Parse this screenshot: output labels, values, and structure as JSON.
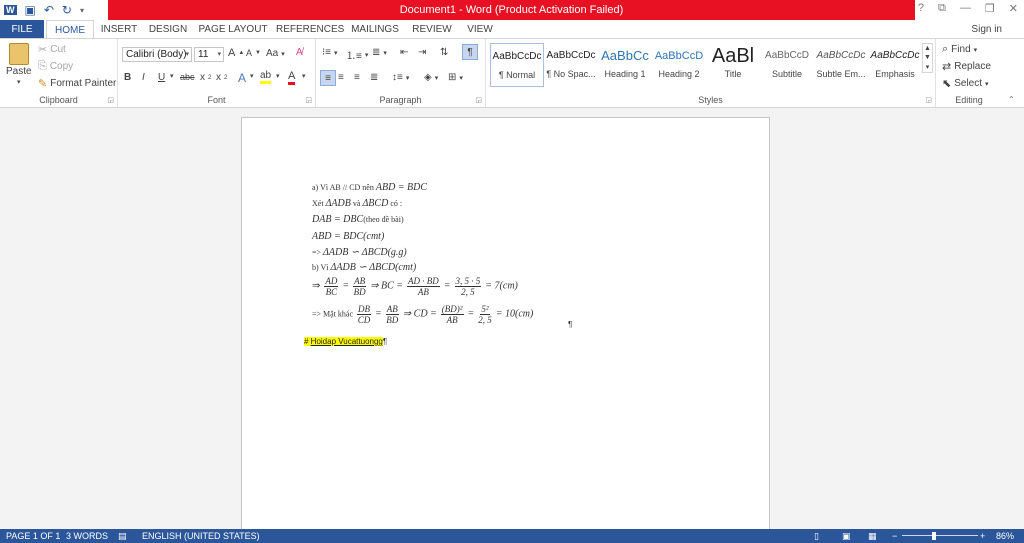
{
  "window": {
    "title": "Document1 - Word (Product Activation Failed)",
    "controls": [
      "?",
      "⧉",
      "—",
      "❐",
      "✕"
    ]
  },
  "qat": {
    "word_icon": "word-logo-icon",
    "save": "save-icon",
    "undo": "undo-icon",
    "redo": "redo-icon"
  },
  "tabs": {
    "file": "FILE",
    "home": "HOME",
    "insert": "INSERT",
    "design": "DESIGN",
    "page_layout": "PAGE LAYOUT",
    "references": "REFERENCES",
    "mailings": "MAILINGS",
    "review": "REVIEW",
    "view": "VIEW",
    "sign_in": "Sign in"
  },
  "clipboard": {
    "paste": "Paste",
    "cut": "Cut",
    "copy": "Copy",
    "format_painter": "Format Painter",
    "label": "Clipboard"
  },
  "font": {
    "name": "Calibri (Body)",
    "size": "11",
    "case": "Aa",
    "label": "Font"
  },
  "paragraph": {
    "label": "Paragraph"
  },
  "styles": {
    "label": "Styles",
    "items": [
      {
        "sample": "AaBbCcDc",
        "name": "¶ Normal"
      },
      {
        "sample": "AaBbCcDc",
        "name": "¶ No Spac..."
      },
      {
        "sample": "AaBbCc",
        "name": "Heading 1"
      },
      {
        "sample": "AaBbCcD",
        "name": "Heading 2"
      },
      {
        "sample": "AaBl",
        "name": "Title"
      },
      {
        "sample": "AaBbCcD",
        "name": "Subtitle"
      },
      {
        "sample": "AaBbCcDc",
        "name": "Subtle Em..."
      },
      {
        "sample": "AaBbCcDc",
        "name": "Emphasis"
      }
    ]
  },
  "editing": {
    "find": "Find",
    "replace": "Replace",
    "select": "Select",
    "label": "Editing"
  },
  "document": {
    "l1_text": "a) Vì AB // CD nên ",
    "l1_math": "ABD = BDC",
    "l2_text": "Xét ",
    "l2_math": "ΔADB",
    "l2_mid": " và ",
    "l2_math2": "ΔBCD",
    "l2_end": " có :",
    "l3_math": "DAB = DBC",
    "l3_text": "(theo đề bài)",
    "l4_math": "ABD = BDC(cmt)",
    "l5_text": "=> ",
    "l5_math": "ΔADB ∽ ΔBCD(g.g)",
    "l6_text": "b) Vì ",
    "l6_math": "ΔADB ∽ ΔBCD(cmt)",
    "l7": {
      "arrow": "⇒",
      "f1n": "AD",
      "f1d": "BC",
      "eq": "=",
      "f2n": "AB",
      "f2d": "BD",
      "mid": "⇒ BC =",
      "f3n": "AD · BD",
      "f3d": "AB",
      "f4n": "3, 5 · 5",
      "f4d": "2, 5",
      "end": "= 7(cm)"
    },
    "l8": {
      "text": "=> Mặt khác ",
      "f1n": "DB",
      "f1d": "CD",
      "f2n": "AB",
      "f2d": "BD",
      "mid": "⇒ CD =",
      "f3n": "(BD)²",
      "f3d": "AB",
      "f4n": "5²",
      "f4d": "2, 5",
      "end": "= 10(cm)"
    },
    "hashtag_prefix": "# ",
    "hashtag": "Hoidap Vucattuongg",
    "pilcrow": "¶"
  },
  "statusbar": {
    "page": "PAGE 1 OF 1",
    "words": "3 WORDS",
    "language": "ENGLISH (UNITED STATES)",
    "zoom": "86%",
    "zoom_minus": "−",
    "zoom_plus": "+"
  }
}
